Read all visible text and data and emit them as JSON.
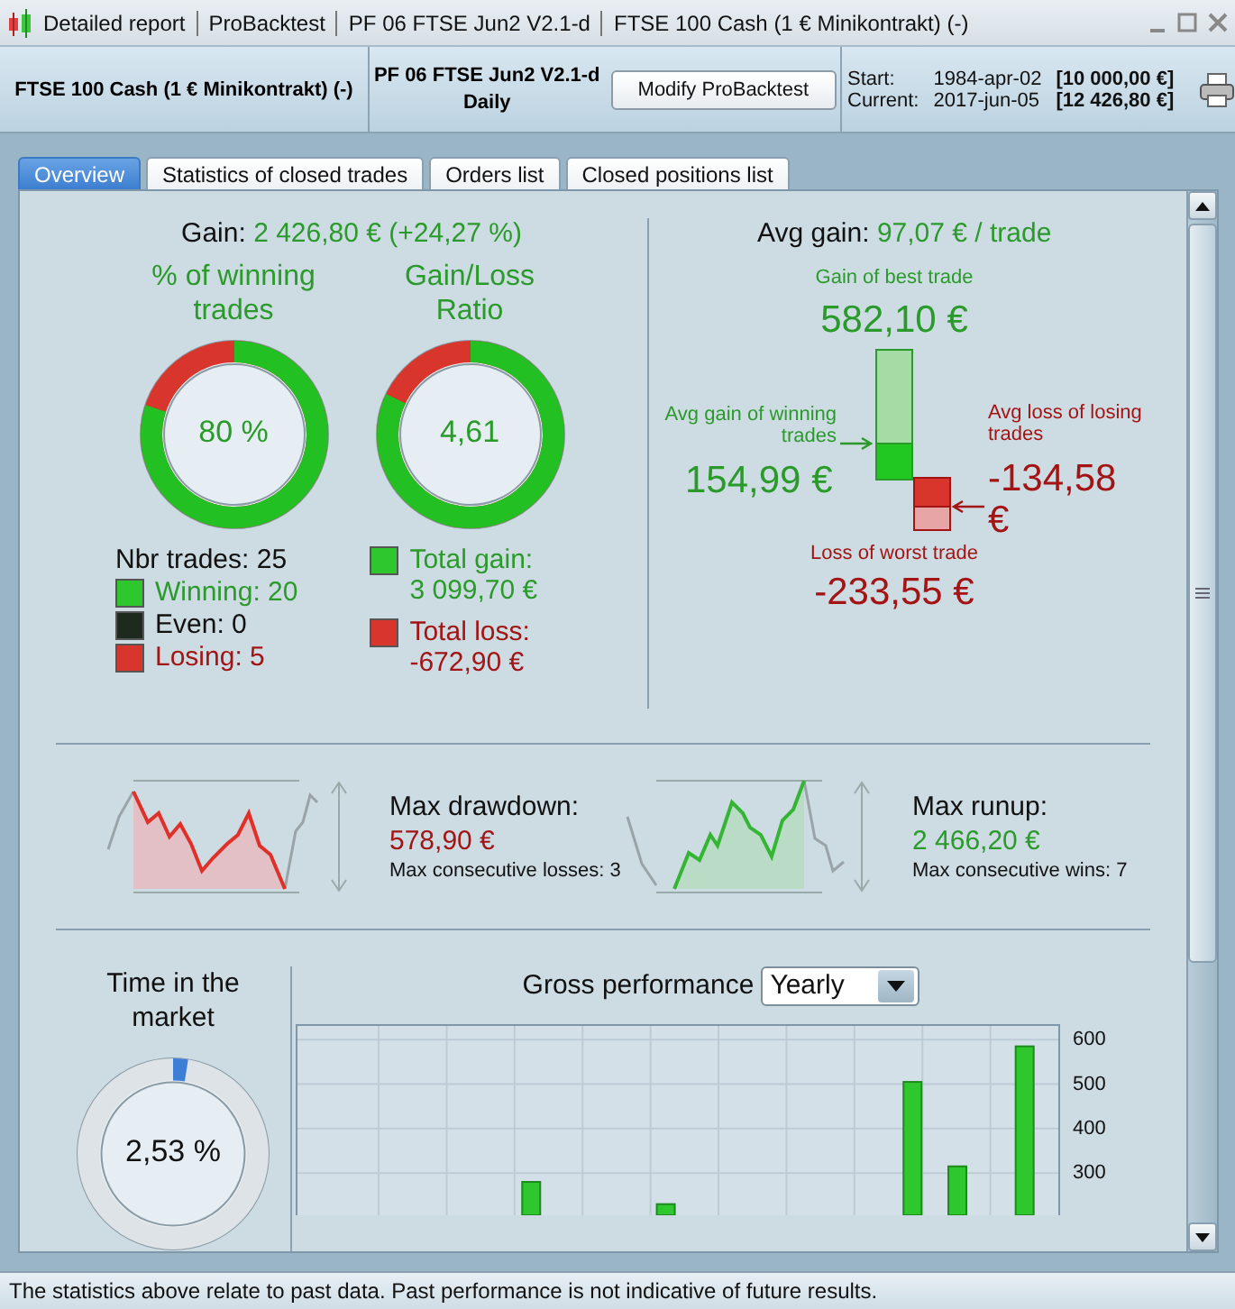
{
  "title_bar": {
    "items": [
      "Detailed report",
      "ProBacktest",
      "PF 06 FTSE Jun2 V2.1-d",
      "FTSE 100 Cash (1 € Minikontrakt) (-)"
    ]
  },
  "header": {
    "instrument": "FTSE 100 Cash (1 € Minikontrakt) (-)",
    "strategy": "PF 06 FTSE Jun2 V2.1-d",
    "timeframe": "Daily",
    "button": "Modify ProBacktest",
    "periods": [
      {
        "label": "Start:",
        "date": "1984-apr-02",
        "amount": "[10 000,00 €]"
      },
      {
        "label": "Current:",
        "date": "2017-jun-05",
        "amount": "[12 426,80 €]"
      }
    ]
  },
  "tabs": [
    {
      "label": "Overview",
      "selected": true
    },
    {
      "label": "Statistics of closed trades",
      "selected": false
    },
    {
      "label": "Orders list",
      "selected": false
    },
    {
      "label": "Closed positions list",
      "selected": false
    }
  ],
  "gain": {
    "label": "Gain:",
    "value": "2 426,80 € (+24,27 %)"
  },
  "rings": [
    {
      "title": "% of winning trades",
      "value": "80 %",
      "level": 0.8
    },
    {
      "title": "Gain/Loss Ratio",
      "value": "4,61",
      "level": 0.82
    }
  ],
  "trades": {
    "total": "Nbr trades: 25",
    "items": [
      {
        "label": "Winning: 20",
        "kind": "win",
        "color": "#2ec82e"
      },
      {
        "label": "Even: 0",
        "kind": "even",
        "color": "#1e2a1e"
      },
      {
        "label": "Losing: 5",
        "kind": "loss",
        "color": "#d8352c"
      }
    ]
  },
  "totals": [
    {
      "label": "Total gain:",
      "value": "3 099,70 €",
      "kind": "win",
      "color": "#2ec82e"
    },
    {
      "label": "Total loss:",
      "value": "-672,90 €",
      "kind": "loss",
      "color": "#d8352c"
    }
  ],
  "avg": {
    "label": "Avg gain:",
    "value": "97,07 € / trade",
    "best": {
      "label": "Gain of best trade",
      "value": "582,10 €"
    },
    "avg_win": {
      "label": "Avg gain of winning trades",
      "value": "154,99 €"
    },
    "avg_loss": {
      "label": "Avg loss of losing trades",
      "value": "-134,58 €"
    },
    "worst": {
      "label": "Loss of worst trade",
      "value": "-233,55 €"
    }
  },
  "extremes": [
    {
      "kind": "drawdown",
      "label": "Max drawdown:",
      "value": "578,90 €",
      "note": "Max consecutive losses: 3"
    },
    {
      "kind": "runup",
      "label": "Max runup:",
      "value": "2 466,20 €",
      "note": "Max consecutive wins: 7"
    }
  ],
  "time_in_market": {
    "title": "Time in the market",
    "value": "2,53 %",
    "level": 0.0253
  },
  "performance": {
    "title": "Gross performance",
    "period": "Yearly",
    "chart_data": {
      "type": "bar",
      "categories": [
        null,
        null,
        null,
        null,
        null,
        null,
        null,
        null,
        null,
        null,
        null,
        null,
        null,
        null,
        null,
        null,
        null,
        null,
        null,
        null,
        null,
        null,
        null,
        null,
        null,
        null,
        null,
        null,
        null,
        null,
        null,
        null,
        null,
        null
      ],
      "values": [
        null,
        null,
        null,
        null,
        null,
        null,
        null,
        null,
        null,
        null,
        280,
        null,
        null,
        null,
        null,
        null,
        230,
        null,
        null,
        null,
        null,
        null,
        null,
        null,
        null,
        null,
        null,
        505,
        null,
        315,
        null,
        null,
        585,
        null
      ],
      "ylim": [
        205,
        635
      ],
      "yticks": [
        300,
        400,
        500,
        600
      ],
      "grid": true
    }
  },
  "status_bar": "The statistics above relate to past data. Past performance is not indicative of future results."
}
